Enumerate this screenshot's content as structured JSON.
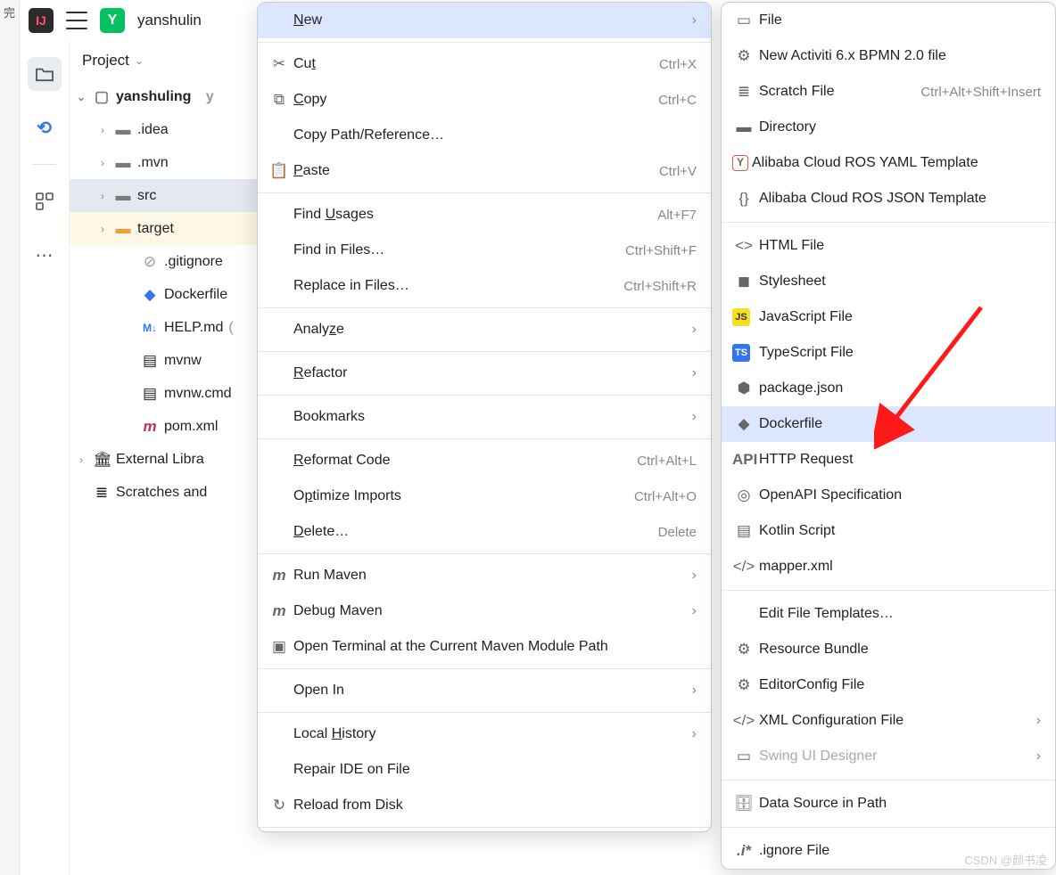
{
  "leftstrip_text": "完",
  "topbar": {
    "project_name": "yanshulin"
  },
  "panel": {
    "title": "Project"
  },
  "tree": {
    "root": "yanshuling",
    "root_extra": "y",
    "items": [
      {
        "name": ".idea",
        "depth": 1,
        "chev": "›",
        "iconColor": "fold-grey"
      },
      {
        "name": ".mvn",
        "depth": 1,
        "chev": "›",
        "iconColor": "fold-grey"
      },
      {
        "name": "src",
        "depth": 1,
        "chev": "›",
        "iconColor": "fold-grey",
        "sel": true
      },
      {
        "name": "target",
        "depth": 1,
        "chev": "›",
        "iconColor": "fold-yellow",
        "hov": true
      },
      {
        "name": ".gitignore",
        "depth": 2,
        "fileglyph": "⊘"
      },
      {
        "name": "Dockerfile",
        "depth": 2,
        "fileglyph": "docker"
      },
      {
        "name": "HELP.md",
        "depth": 2,
        "fileglyph": "md",
        "extra": "("
      },
      {
        "name": "mvnw",
        "depth": 2,
        "fileglyph": "sh"
      },
      {
        "name": "mvnw.cmd",
        "depth": 2,
        "fileglyph": "sh"
      },
      {
        "name": "pom.xml",
        "depth": 2,
        "fileglyph": "m"
      }
    ],
    "external": "External Libra",
    "scratches": "Scratches and"
  },
  "context_menu": [
    {
      "label": "New",
      "u": 0,
      "arrow": true,
      "selected": true
    },
    "sep",
    {
      "icon": "✂",
      "label": "Cut",
      "u": 2,
      "shortcut": "Ctrl+X"
    },
    {
      "icon": "⧉",
      "label": "Copy",
      "u": 0,
      "shortcut": "Ctrl+C"
    },
    {
      "label": "Copy Path/Reference…"
    },
    {
      "icon": "📋",
      "label": "Paste",
      "u": 0,
      "shortcut": "Ctrl+V"
    },
    "sep",
    {
      "label": "Find Usages",
      "u": 5,
      "shortcut": "Alt+F7"
    },
    {
      "label": "Find in Files…",
      "shortcut": "Ctrl+Shift+F"
    },
    {
      "label": "Replace in Files…",
      "shortcut": "Ctrl+Shift+R"
    },
    "sep",
    {
      "label": "Analyze",
      "u": 5,
      "arrow": true
    },
    "sep",
    {
      "label": "Refactor",
      "u": 0,
      "arrow": true
    },
    "sep",
    {
      "label": "Bookmarks",
      "arrow": true
    },
    "sep",
    {
      "label": "Reformat Code",
      "u": 0,
      "shortcut": "Ctrl+Alt+L"
    },
    {
      "label": "Optimize Imports",
      "u": 1,
      "shortcut": "Ctrl+Alt+O"
    },
    {
      "label": "Delete…",
      "u": 0,
      "shortcut": "Delete"
    },
    "sep",
    {
      "icon": "m",
      "iconColor": "blue",
      "label": "Run Maven",
      "arrow": true
    },
    {
      "icon": "m",
      "iconColor": "blue",
      "label": "Debug Maven",
      "arrow": true
    },
    {
      "icon": "term",
      "label": "Open Terminal at the Current Maven Module Path"
    },
    "sep",
    {
      "label": "Open In",
      "arrow": true
    },
    "sep",
    {
      "label": "Local History",
      "u": 6,
      "arrow": true
    },
    {
      "label": "Repair IDE on File"
    },
    {
      "icon": "↻",
      "label": "Reload from Disk"
    },
    "sep"
  ],
  "new_submenu": [
    {
      "icon": "file",
      "label": "File"
    },
    {
      "icon": "bpmn",
      "label": "New Activiti 6.x BPMN 2.0 file"
    },
    {
      "icon": "scratch",
      "label": "Scratch File",
      "shortcut": "Ctrl+Alt+Shift+Insert"
    },
    {
      "icon": "folder",
      "label": "Directory"
    },
    {
      "icon": "yaml",
      "label": "Alibaba Cloud ROS YAML Template"
    },
    {
      "icon": "json",
      "label": "Alibaba Cloud ROS JSON Template"
    },
    "sep",
    {
      "icon": "html",
      "label": "HTML File"
    },
    {
      "icon": "css",
      "label": "Stylesheet"
    },
    {
      "icon": "js",
      "label": "JavaScript File"
    },
    {
      "icon": "ts",
      "label": "TypeScript File"
    },
    {
      "icon": "node",
      "label": "package.json"
    },
    {
      "icon": "docker",
      "label": "Dockerfile",
      "selected": true
    },
    {
      "icon": "api",
      "label": "HTTP Request"
    },
    {
      "icon": "openapi",
      "label": "OpenAPI Specification"
    },
    {
      "icon": "kotlin",
      "label": "Kotlin Script"
    },
    {
      "icon": "xml",
      "label": "mapper.xml"
    },
    "sep",
    {
      "label": "Edit File Templates…"
    },
    {
      "icon": "gear",
      "label": "Resource Bundle"
    },
    {
      "icon": "gear",
      "label": "EditorConfig File"
    },
    {
      "icon": "xml",
      "label": "XML Configuration File",
      "arrow": true
    },
    {
      "icon": "swing",
      "label": "Swing UI Designer",
      "muted": true,
      "arrow": true
    },
    "sep",
    {
      "icon": "db",
      "label": "Data Source in Path"
    },
    "sep",
    {
      "icon": "ignore",
      "label": ".ignore File"
    }
  ],
  "watermark": "CSDN @颜书凌"
}
